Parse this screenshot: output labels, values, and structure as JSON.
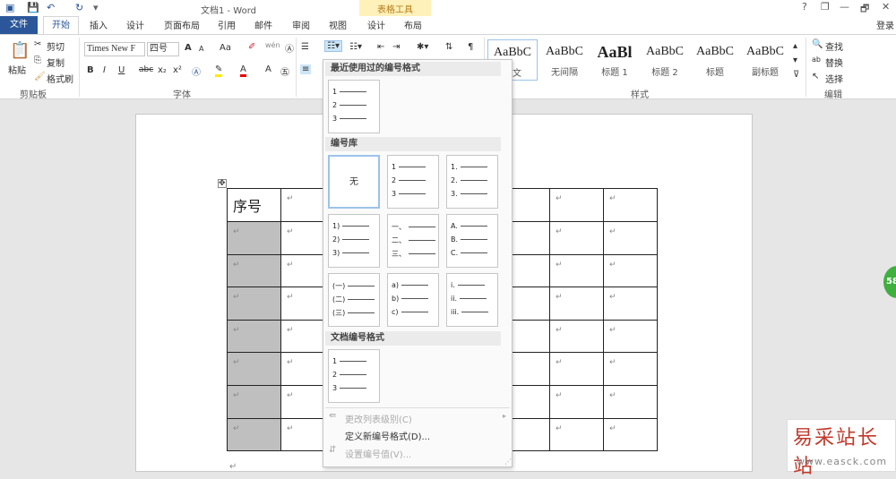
{
  "window": {
    "title": "文档1 - Word",
    "table_tools": "表格工具",
    "help": "?",
    "min": "—",
    "restore": "❐",
    "close": "✕",
    "signin": "登录",
    "account": "登录"
  },
  "tabs": {
    "file": "文件",
    "home": "开始",
    "insert": "插入",
    "design": "设计",
    "layout": "页面布局",
    "references": "引用",
    "mailings": "邮件",
    "review": "审阅",
    "view": "视图",
    "table_design": "设计",
    "table_layout": "布局"
  },
  "clipboard": {
    "paste": "粘贴",
    "cut": "剪切",
    "copy": "复制",
    "format_painter": "格式刷",
    "label": "剪贴板"
  },
  "font": {
    "name": "Times New F",
    "size": "四号",
    "bold": "B",
    "italic": "I",
    "underline": "U",
    "strike": "abc",
    "sub": "x₂",
    "sup": "x²",
    "grow": "A",
    "shrink": "A",
    "case": "Aa",
    "label": "字体"
  },
  "styles": {
    "label": "样式",
    "items": [
      {
        "preview": "AaBbC",
        "name": "正文"
      },
      {
        "preview": "AaBbC",
        "name": "无间隔"
      },
      {
        "preview": "AaBl",
        "name": "标题 1"
      },
      {
        "preview": "AaBbC",
        "name": "标题 2"
      },
      {
        "preview": "AaBbC",
        "name": "标题"
      },
      {
        "preview": "AaBbC",
        "name": "副标题"
      }
    ]
  },
  "editing": {
    "find": "查找",
    "replace": "替换",
    "select": "选择",
    "label": "编辑"
  },
  "numbering_menu": {
    "recent_header": "最近使用过的编号格式",
    "library_header": "编号库",
    "doc_header": "文档编号格式",
    "none_label": "无",
    "recent": [
      "1",
      "2",
      "3"
    ],
    "library": [
      [
        "1",
        "2",
        "3"
      ],
      [
        "1.",
        "2.",
        "3."
      ],
      [
        "1)",
        "2)",
        "3)"
      ],
      [
        "一、",
        "二、",
        "三、"
      ],
      [
        "A.",
        "B.",
        "C."
      ],
      [
        "(一)",
        "(二)",
        "(三)"
      ],
      [
        "a)",
        "b)",
        "c)"
      ],
      [
        "i.",
        "ii.",
        "iii."
      ]
    ],
    "document": [
      "1",
      "2",
      "3"
    ],
    "change_level": "更改列表级别(C)",
    "define_new": "定义新编号格式(D)...",
    "set_value": "设置编号值(V)..."
  },
  "document": {
    "table_header": "序号",
    "para_mark": "↵"
  },
  "watermark": {
    "cn": "易采站长站",
    "url": "www.easck.com"
  },
  "badge": {
    "text": "58"
  }
}
